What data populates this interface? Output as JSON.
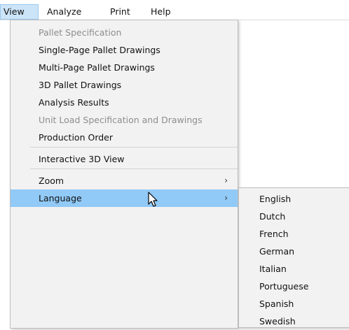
{
  "menubar": {
    "items": [
      {
        "label": "View",
        "active": true
      },
      {
        "label": "Analyze"
      },
      {
        "label": "Print"
      },
      {
        "label": "Help"
      }
    ]
  },
  "view_menu": {
    "items": [
      {
        "label": "Pallet Specification",
        "enabled": false
      },
      {
        "label": "Single-Page Pallet Drawings",
        "enabled": true
      },
      {
        "label": "Multi-Page Pallet Drawings",
        "enabled": true
      },
      {
        "label": "3D Pallet Drawings",
        "enabled": true
      },
      {
        "label": "Analysis Results",
        "enabled": true
      },
      {
        "label": "Unit Load Specification and Drawings",
        "enabled": false
      },
      {
        "label": "Production Order",
        "enabled": true
      },
      {
        "label": "Interactive 3D View",
        "enabled": true
      },
      {
        "label": "Zoom",
        "enabled": true,
        "submenu": true
      },
      {
        "label": "Language",
        "enabled": true,
        "submenu": true,
        "highlighted": true
      }
    ],
    "submenu_arrow": "›"
  },
  "language_submenu": {
    "items": [
      "English",
      "Dutch",
      "French",
      "German",
      "Italian",
      "Portuguese",
      "Spanish",
      "Swedish"
    ]
  },
  "colors": {
    "highlight": "#91c9f7",
    "menu_bg": "#f2f2f2",
    "disabled_text": "#8d8d8d"
  }
}
